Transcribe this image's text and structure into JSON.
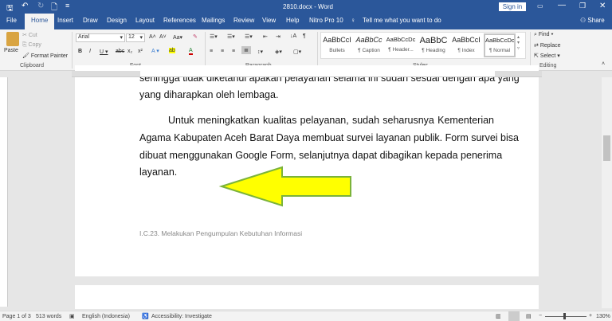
{
  "titlebar": {
    "title": "2810.docx - Word",
    "sign_in": "Sign in"
  },
  "tabs": [
    "File",
    "Home",
    "Insert",
    "Draw",
    "Design",
    "Layout",
    "References",
    "Mailings",
    "Review",
    "View",
    "Help",
    "Nitro Pro 10"
  ],
  "tell_me": "Tell me what you want to do",
  "share": "Share",
  "clipboard": {
    "paste": "Paste",
    "cut": "Cut",
    "copy": "Copy",
    "format_painter": "Format Painter",
    "label": "Clipboard"
  },
  "font": {
    "name": "Arial",
    "size": "12",
    "label": "Font"
  },
  "paragraph": {
    "label": "Paragraph"
  },
  "styles": {
    "label": "Styles",
    "items": [
      {
        "sample": "AaBbCcI",
        "name": "Bullets"
      },
      {
        "sample": "AaBbCc",
        "name": "¶ Caption"
      },
      {
        "sample": "AaBbCcDc",
        "name": "¶ Header..."
      },
      {
        "sample": "AaBbC",
        "name": "¶ Heading"
      },
      {
        "sample": "AaBbCcI",
        "name": "¶ Index"
      },
      {
        "sample": "AaBbCcDc",
        "name": "¶ Normal"
      }
    ]
  },
  "editing": {
    "find": "Find",
    "replace": "Replace",
    "select": "Select",
    "label": "Editing"
  },
  "document": {
    "lines": [
      "sehingga tidak diketahui apakah pelayanan selama ini sudah sesuai dengan apa yang",
      "yang diharapkan oleh lembaga.",
      "Untuk meningkatkan kualitas pelayanan, sudah seharusnya Kementerian",
      "Agama Kabupaten Aceh Barat Daya membuat survei layanan publik. Form survei bisa",
      "dibuat menggunakan Google Form, selanjutnya dapat dibagikan kepada penerima",
      "layanan."
    ],
    "footer": "I.C.23. Melakukan Pengumpulan Kebutuhan Informasi",
    "arrow_color": "#ffff00"
  },
  "status": {
    "page": "Page 1 of 3",
    "words": "513 words",
    "language": "English (Indonesia)",
    "accessibility": "Accessibility: Investigate",
    "zoom": "130%"
  }
}
